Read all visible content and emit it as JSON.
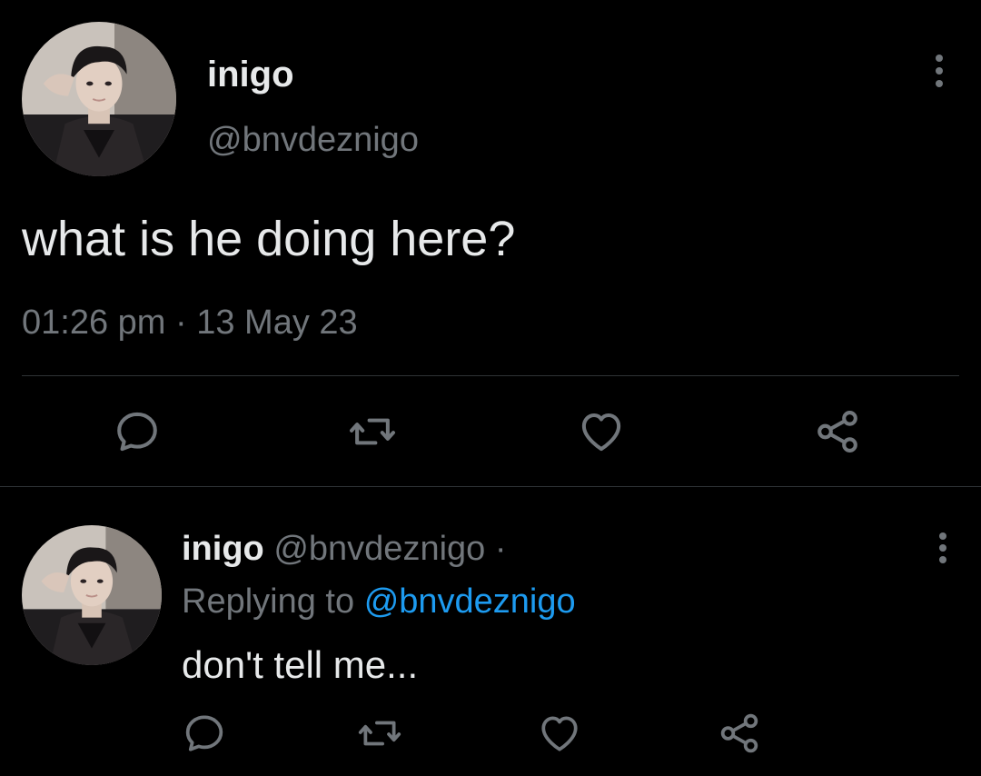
{
  "main_tweet": {
    "author_name": "inigo",
    "author_handle": "@bnvdeznigo",
    "text": "what is he doing here?",
    "time": "01:26 pm",
    "separator": "·",
    "date": "13 May 23",
    "actions": [
      "reply-icon",
      "retweet-icon",
      "like-icon",
      "share-icon"
    ]
  },
  "reply_tweet": {
    "author_name": "inigo",
    "author_handle": "@bnvdeznigo",
    "dot": "·",
    "replying_prefix": "Replying to",
    "replying_handle": "@bnvdeznigo",
    "text": "don't tell me...",
    "actions": [
      "reply-icon",
      "retweet-icon",
      "like-icon",
      "share-icon"
    ]
  },
  "colors": {
    "background": "#000000",
    "text_primary": "#e7e9ea",
    "text_secondary": "#71767b",
    "link": "#1d9bf0",
    "divider": "#2f3336"
  }
}
